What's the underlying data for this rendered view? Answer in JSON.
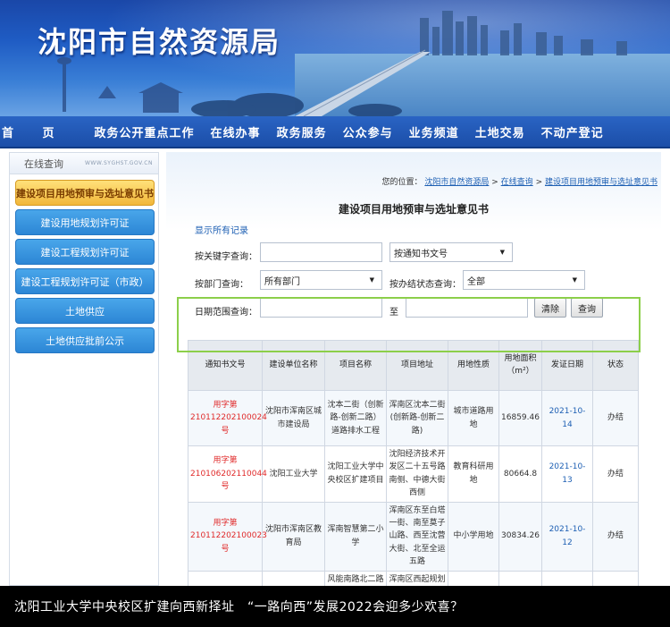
{
  "banner": {
    "title": "沈阳市自然资源局"
  },
  "nav": [
    "首 页",
    "政务公开重点工作",
    "在线办事",
    "政务服务",
    "公众参与",
    "业务频道",
    "土地交易",
    "不动产登记"
  ],
  "sidebar": {
    "header": "在线查询",
    "url": "WWW.SYGHST.GOV.CN",
    "items": [
      "建设项目用地预审与选址意见书",
      "建设用地规划许可证",
      "建设工程规划许可证",
      "建设工程规划许可证（市政）",
      "土地供应",
      "土地供应批前公示"
    ]
  },
  "breadcrumb": {
    "prefix": "您的位置：",
    "home": "沈阳市自然资源局",
    "sep": ">",
    "level2": "在线查询",
    "level3": "建设项目用地预审与选址意见书"
  },
  "page_title": "建设项目用地预审与选址意见书",
  "show_all": "显示所有记录",
  "form": {
    "keyword_label": "按关键字查询：",
    "keyword_value": "",
    "keyword_type": "按通知书文号",
    "dept_label": "按部门查询：",
    "dept_value": "所有部门",
    "status_label": "按办结状态查询：",
    "status_value": "全部",
    "date_label": "日期范围查询：",
    "date_to": "至",
    "clear": "清除",
    "search": "查询"
  },
  "table": {
    "headers": [
      "通知书文号",
      "建设单位名称",
      "项目名称",
      "项目地址",
      "用地性质",
      "用地面积（m²）",
      "发证日期",
      "状态"
    ],
    "rows": [
      {
        "no": "用字第210112202100024号",
        "unit": "沈阳市浑南区城市建设局",
        "name": "沈本二街（创新路-创新二路）道路排水工程",
        "addr": "浑南区沈本二街(创新路-创新二路)",
        "use": "城市道路用地",
        "area": "16859.46",
        "date": "2021-10-14",
        "status": "办结"
      },
      {
        "no": "用字第210106202110044号",
        "unit": "沈阳工业大学",
        "name": "沈阳工业大学中央校区扩建项目",
        "addr": "沈阳经济技术开发区二十五号路南侧、中德大街西侧",
        "use": "教育科研用地",
        "area": "80664.8",
        "date": "2021-10-13",
        "status": "办结"
      },
      {
        "no": "用字第210112202100023号",
        "unit": "沈阳市浑南区教育局",
        "name": "浑南智慧第二小学",
        "addr": "浑南区东至白塔一街、南至莫子山路、西至沈营大街、北至全运五路",
        "use": "中小学用地",
        "area": "30834.26",
        "date": "2021-10-12",
        "status": "办结"
      },
      {
        "no": "",
        "unit": "",
        "name": "风能南路北二路",
        "addr": "浑南区西起规划",
        "use": "",
        "area": "",
        "date": "",
        "status": ""
      }
    ]
  },
  "caption": "沈阳工业大学中央校区扩建向西新择址　“一路向西”发展2022会迎多少欢喜？"
}
